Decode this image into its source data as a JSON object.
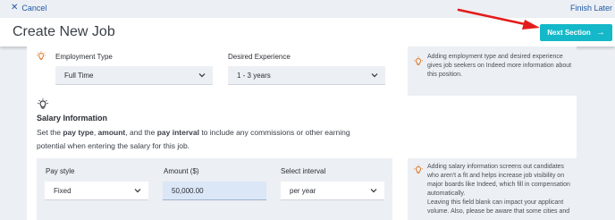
{
  "topbar": {
    "cancel_label": "Cancel",
    "cancel_icon": "close-icon",
    "finish_label": "Finish Later"
  },
  "header": {
    "title": "Create New Job",
    "next_label": "Next Section",
    "next_icon": "arrow-right-icon",
    "accent_color": "#14b8c8"
  },
  "employment": {
    "type_label": "Employment Type",
    "type_value": "Full Time",
    "experience_label": "Desired Experience",
    "experience_value": "1 - 3 years",
    "tip": "Adding employment type and desired experience gives job seekers on Indeed more information about this position."
  },
  "salary": {
    "title": "Salary Information",
    "desc_1": "Set the ",
    "desc_b1": "pay type",
    "desc_2": ", ",
    "desc_b2": "amount",
    "desc_3": ", and the ",
    "desc_b3": "pay interval",
    "desc_4": " to include any commissions or other earning potential when entering the salary for this job.",
    "pay_style_label": "Pay style",
    "pay_style_value": "Fixed",
    "amount_label": "Amount ($)",
    "amount_value": "50,000.00",
    "interval_label": "Select interval",
    "interval_value": "per year",
    "tip": "Adding salary information screens out candidates who aren't a fit and helps increase job visibility on major boards like Indeed, which fill in compensation automatically.",
    "tip_2": "Leaving this field blank can impact your applicant volume. Also, please be aware that some cities and"
  }
}
